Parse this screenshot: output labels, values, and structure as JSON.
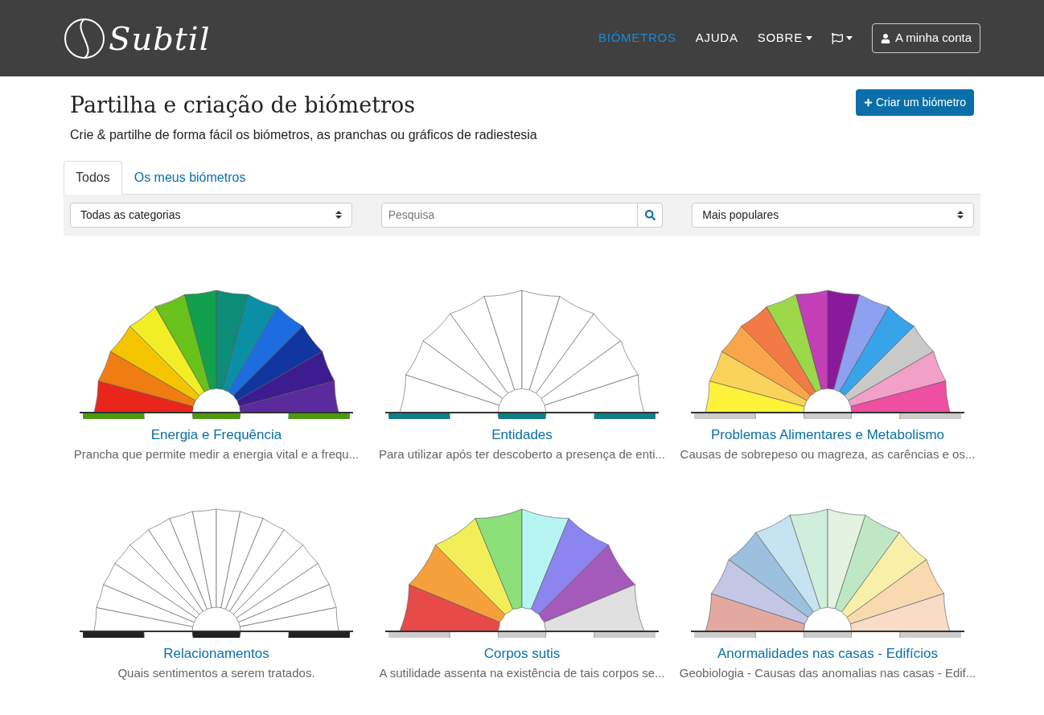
{
  "nav": {
    "logo": "Subtil",
    "links": [
      {
        "label": "BIÓMETROS",
        "selected": true,
        "dropdown": false
      },
      {
        "label": "AJUDA",
        "selected": false,
        "dropdown": false
      },
      {
        "label": "SOBRE",
        "selected": false,
        "dropdown": true
      }
    ],
    "account": "A minha conta"
  },
  "header": {
    "title": "Partilha e criação de biómetros",
    "subtitle": "Crie & partilhe de forma fácil os biómetros, as pranchas ou gráficos de radiestesia",
    "create_button": "Criar um biómetro"
  },
  "tabs": [
    {
      "label": "Todos",
      "selected": true
    },
    {
      "label": "Os meus biómetros",
      "selected": false
    }
  ],
  "filters": {
    "category": "Todas as categorias",
    "search": {
      "placeholder": "Pesquisa"
    },
    "sort": "Mais populares"
  },
  "cards": [
    {
      "title": "Energia e Frequência",
      "description": "Prancha que permite medir a energia vital e a frequ..."
    },
    {
      "title": "Entidades",
      "description": "Para utilizar após ter descoberto a presença de enti..."
    },
    {
      "title": "Problemas Alimentares e Metabolismo",
      "description": "Causas de sobrepeso ou magreza, as carências e os..."
    },
    {
      "title": "Relacionamentos",
      "description": "Quais sentimentos a serem tratados."
    },
    {
      "title": "Corpos sutis",
      "description": "A sutilidade assenta na existência de tais corpos se..."
    },
    {
      "title": "Anormalidades nas casas - Edifícios",
      "description": "Geobiologia - Causas das anomalias nas casas - Edif..."
    }
  ]
}
